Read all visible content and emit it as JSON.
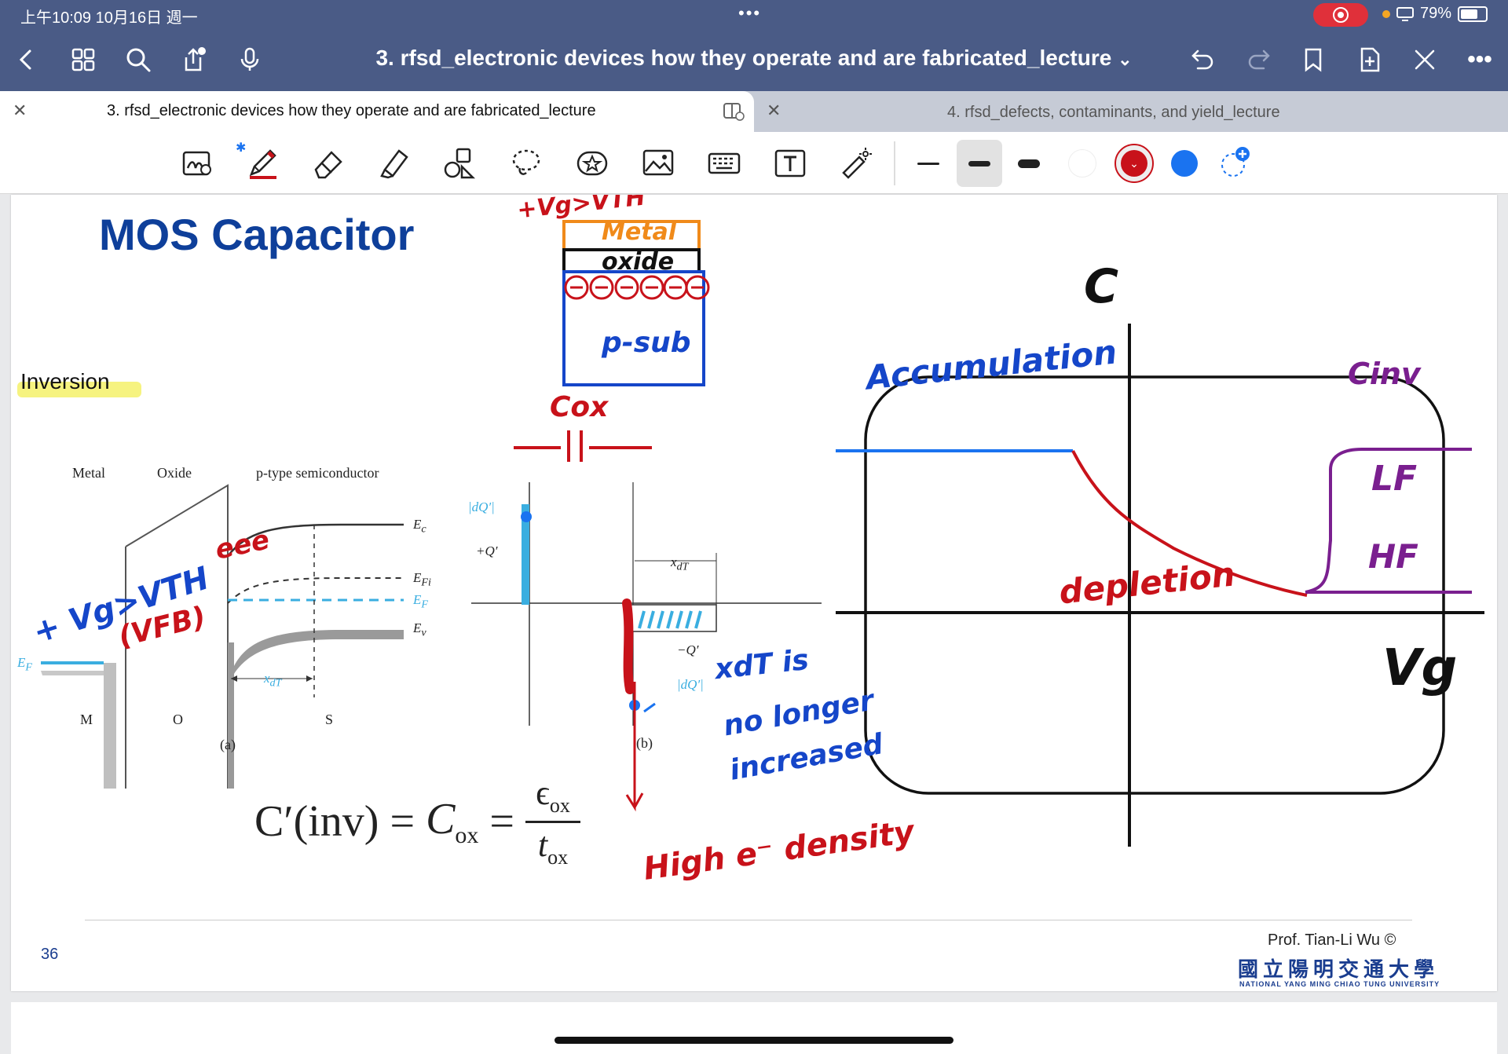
{
  "status_bar": {
    "time": "上午10:09   10月16日 週一",
    "dots": "•••",
    "battery": "79%",
    "battery_level": 0.79
  },
  "header": {
    "title": "3. rfsd_electronic devices how they operate and are fabricated_lecture",
    "title_chevron": "⌄"
  },
  "tabs": [
    {
      "label": "3. rfsd_electronic devices how they operate and are fabricated_lecture",
      "active": true
    },
    {
      "label": "4. rfsd_defects, contaminants, and yield_lecture",
      "active": false
    }
  ],
  "toolbar": {
    "pen_color": "#c8121a",
    "selected_color": "#c8121a",
    "colors": [
      "#ffffff",
      "#c8121a",
      "#1a73f0"
    ]
  },
  "slide": {
    "title": "MOS Capacitor",
    "section_label": "Inversion",
    "page_number": "36",
    "prof": "Prof. Tian-Li Wu ©",
    "university_cn": "國立陽明交通大學",
    "university_en": "NATIONAL YANG MING CHIAO TUNG UNIVERSITY",
    "figure_a": {
      "metal": "Metal",
      "oxide": "Oxide",
      "semiconductor": "p-type semiconductor",
      "ec": "E",
      "ec_sub": "c",
      "efi": "E",
      "efi_sub": "Fi",
      "ef": "E",
      "ef_sub": "F",
      "ev": "E",
      "ev_sub": "v",
      "ef_left": "E",
      "ef_left_sub": "F",
      "xdt": "x",
      "xdt_sub": "dT",
      "m": "M",
      "o": "O",
      "s": "S",
      "caption": "(a)"
    },
    "figure_b": {
      "dq_top": "|dQ′|",
      "plus_q": "+Q′",
      "xdt": "x",
      "xdt_sub": "dT",
      "minus_q": "−Q′",
      "dq_bottom": "|dQ′|",
      "caption": "(b)"
    },
    "equation": {
      "lhs": "C′(inv)",
      "eq1": "=",
      "mid": "C",
      "mid_sub": "ox",
      "eq2": "=",
      "num": "ϵ",
      "num_sub": "ox",
      "den": "t",
      "den_sub": "ox"
    },
    "annotations": {
      "vg_vth_top": "+Vg>VTH",
      "metal": "Metal",
      "oxide": "oxide",
      "psub": "p-sub",
      "cox": "Cox",
      "eee": "eee",
      "vg_vth_left": "+ Vg>VTH",
      "vfb": "(VFB)",
      "xdt_note_1": "xdT is",
      "xdt_note_2": "no longer",
      "xdt_note_3": "increased",
      "high_density": "High e⁻ density",
      "c_axis": "C",
      "vg_axis": "Vg",
      "accumulation": "Accumulation",
      "depletion": "depletion",
      "cinv": "Cinv",
      "lf": "LF",
      "hf": "HF"
    }
  }
}
